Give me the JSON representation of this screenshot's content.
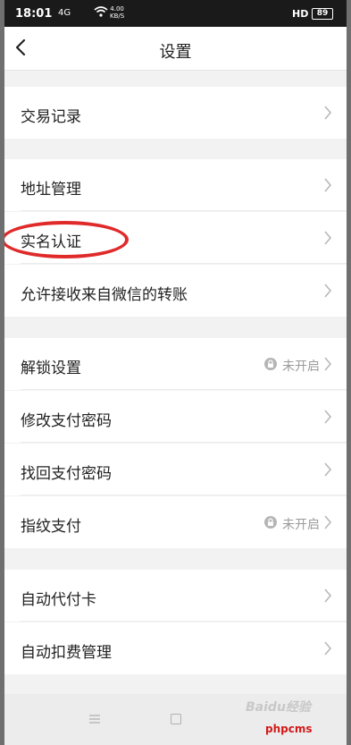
{
  "status_bar": {
    "time": "18:01",
    "signal": "4G",
    "speed_value": "4.00",
    "speed_unit": "KB/S",
    "hd": "HD",
    "battery": "89"
  },
  "header": {
    "title": "设置"
  },
  "groups": [
    {
      "items": [
        {
          "label": "交易记录"
        }
      ]
    },
    {
      "items": [
        {
          "label": "地址管理"
        },
        {
          "label": "实名认证"
        },
        {
          "label": "允许接收来自微信的转账"
        }
      ]
    },
    {
      "items": [
        {
          "label": "解锁设置",
          "status": "未开启"
        },
        {
          "label": "修改支付密码"
        },
        {
          "label": "找回支付密码"
        },
        {
          "label": "指纹支付",
          "status": "未开启"
        }
      ]
    },
    {
      "items": [
        {
          "label": "自动代付卡"
        },
        {
          "label": "自动扣费管理"
        }
      ]
    }
  ],
  "watermark": {
    "line1": "Baidu经验",
    "line2": "phpcms"
  },
  "colors": {
    "highlight": "#e02a2a",
    "watermark_red": "#d21a1a"
  }
}
